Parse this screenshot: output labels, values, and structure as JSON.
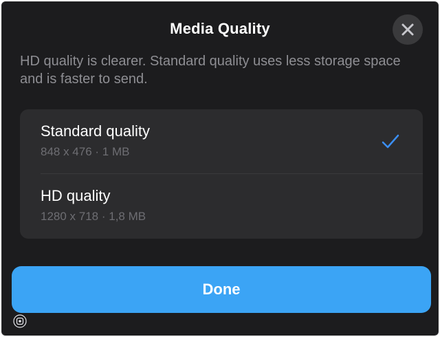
{
  "dialog": {
    "title": "Media Quality",
    "description": "HD quality is clearer. Standard quality uses less storage space and is faster to send.",
    "close_icon": "close-icon"
  },
  "options": [
    {
      "label": "Standard quality",
      "details": "848 x 476 · 1 MB",
      "selected": true
    },
    {
      "label": "HD quality",
      "details": "1280 x 718 · 1,8 MB",
      "selected": false
    }
  ],
  "done_button": {
    "label": "Done"
  },
  "colors": {
    "sheet_background": "#1c1c1e",
    "panel_background": "#2c2c2e",
    "accent": "#3ba4f5",
    "checkmark": "#3b8ff5",
    "secondary_text": "#8e8e93"
  },
  "icons": {
    "close": "close-icon",
    "selected": "checkmark-icon",
    "overlay": "lens-icon"
  }
}
